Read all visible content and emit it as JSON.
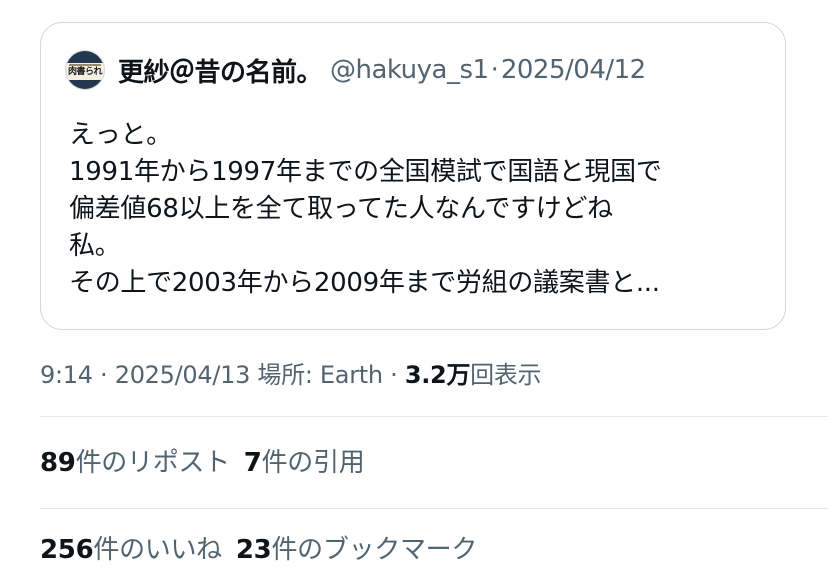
{
  "quoted_post": {
    "avatar_icon": "newspaper-masthead-avatar",
    "avatar_text": "肉書られ",
    "display_name": "更紗＠昔の名前。",
    "handle": "@hakuya_s1",
    "separator": "·",
    "date": "2025/04/12",
    "lines": [
      "えっと。",
      "1991年から1997年までの全国模試で国語と現国で",
      "偏差値68以上を全て取ってた人なんですけどね",
      "私。",
      "その上で2003年から2009年まで労組の議案書と..."
    ]
  },
  "meta": {
    "time": "9:14",
    "sep1": "·",
    "date": "2025/04/13",
    "location_label": "場所: Earth",
    "sep2": "·",
    "views_count": "3.2万",
    "views_label": "回表示"
  },
  "stats": {
    "reposts_count": "89",
    "reposts_label": "件のリポスト",
    "quotes_count": "7",
    "quotes_label": "件の引用",
    "likes_count": "256",
    "likes_label": "件のいいね",
    "bookmarks_count": "23",
    "bookmarks_label": "件のブックマーク"
  },
  "colors": {
    "text_primary": "#0f1419",
    "text_secondary": "#536471",
    "border": "#cfd9de",
    "divider": "#e7e9ea"
  }
}
